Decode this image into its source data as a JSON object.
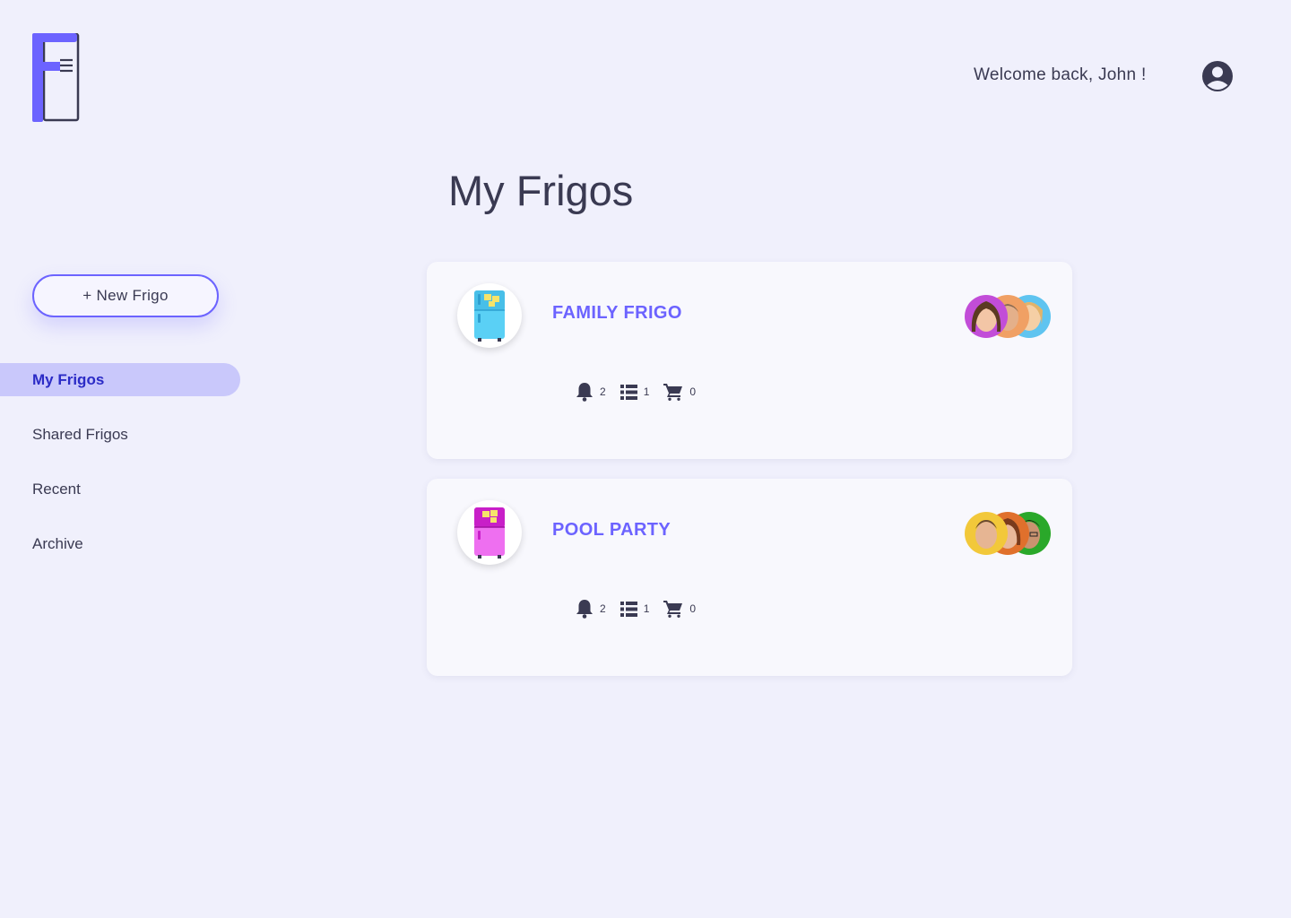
{
  "header": {
    "welcome_text": "Welcome back, John !"
  },
  "page": {
    "title": "My Frigos"
  },
  "sidebar": {
    "new_button_label": "+ New Frigo",
    "items": [
      {
        "label": "My Frigos",
        "active": true
      },
      {
        "label": "Shared Frigos",
        "active": false
      },
      {
        "label": "Recent",
        "active": false
      },
      {
        "label": "Archive",
        "active": false
      }
    ]
  },
  "frigos": [
    {
      "name": "FAMILY FRIGO",
      "fridge_color": "#5ad0f5",
      "icon": "fridge-icon",
      "notifications": "2",
      "lists": "1",
      "cart": "0",
      "member_avatar_colors": [
        "#c24dd8",
        "#f0a064",
        "#5fc4f0"
      ]
    },
    {
      "name": "POOL PARTY",
      "fridge_color": "#e659e6",
      "icon": "fridge-icon",
      "notifications": "2",
      "lists": "1",
      "cart": "0",
      "member_avatar_colors": [
        "#f2c83a",
        "#e0702c",
        "#2aa82a"
      ]
    }
  ],
  "colors": {
    "accent": "#6c63ff",
    "background": "#f0f0fc",
    "nav_active_bg": "#c9c8fb",
    "nav_active_text": "#2b2bc6"
  },
  "icons": [
    "fridge-logo-icon",
    "account-circle-icon",
    "bell-icon",
    "list-icon",
    "cart-icon"
  ]
}
